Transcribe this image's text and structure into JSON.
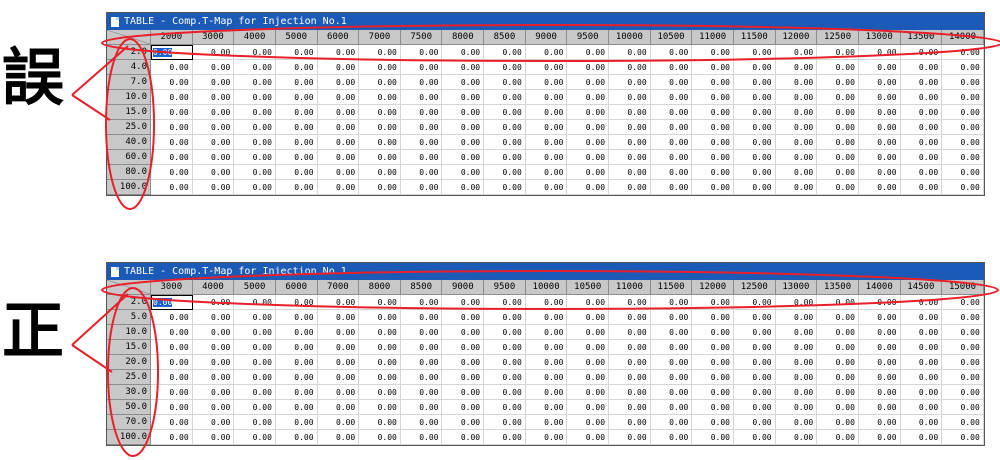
{
  "labels": {
    "wrong": "誤",
    "correct": "正"
  },
  "colors": {
    "titlebar": "#1c5ab8",
    "annotation": "#e8202a"
  },
  "tables": [
    {
      "title": "TABLE - Comp.T-Map for Injection No.1",
      "columns": [
        "2000",
        "3000",
        "4000",
        "5000",
        "6000",
        "7000",
        "7500",
        "8000",
        "8500",
        "9000",
        "9500",
        "10000",
        "10500",
        "11000",
        "11500",
        "12000",
        "12500",
        "13000",
        "13500",
        "14000"
      ],
      "rows": [
        "2.0",
        "4.0",
        "7.0",
        "10.0",
        "15.0",
        "25.0",
        "40.0",
        "60.0",
        "80.0",
        "100.0"
      ],
      "cell_value": "0.00"
    },
    {
      "title": "TABLE - Comp.T-Map for Injection No.1",
      "columns": [
        "3000",
        "4000",
        "5000",
        "6000",
        "7000",
        "8000",
        "8500",
        "9000",
        "9500",
        "10000",
        "10500",
        "11000",
        "11500",
        "12000",
        "12500",
        "13000",
        "13500",
        "14000",
        "14500",
        "15000"
      ],
      "rows": [
        "2.0",
        "5.0",
        "10.0",
        "15.0",
        "20.0",
        "25.0",
        "30.0",
        "50.0",
        "70.0",
        "100.0"
      ],
      "cell_value": "0.00"
    }
  ]
}
